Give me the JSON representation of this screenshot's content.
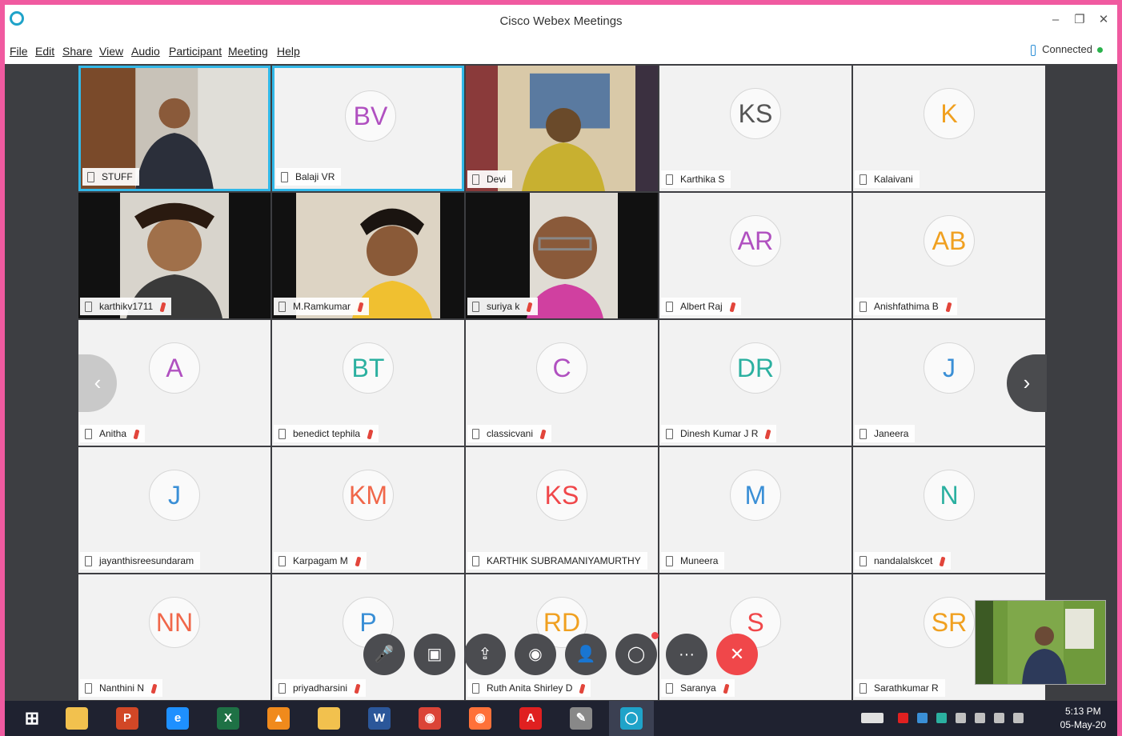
{
  "window": {
    "title": "Cisco Webex Meetings",
    "controls": [
      "–",
      "❐",
      "✕"
    ]
  },
  "menu": [
    "File",
    "Edit",
    "Share",
    "View",
    "Audio",
    "Participant",
    "Meeting",
    "Help"
  ],
  "connection": {
    "status": "Connected"
  },
  "participants": [
    {
      "name": "STUFF",
      "initials": "",
      "video": true,
      "muted": false,
      "color": "#444444"
    },
    {
      "name": "Balaji VR",
      "initials": "BV",
      "video": false,
      "muted": false,
      "color": "#b050c0"
    },
    {
      "name": "Devi",
      "initials": "",
      "video": true,
      "muted": false,
      "color": "#444444"
    },
    {
      "name": "Karthika S",
      "initials": "KS",
      "video": false,
      "muted": false,
      "color": "#555555"
    },
    {
      "name": "Kalaivani",
      "initials": "K",
      "video": false,
      "muted": false,
      "color": "#f0a020"
    },
    {
      "name": "karthikv1711",
      "initials": "",
      "video": true,
      "muted": true,
      "color": "#444444"
    },
    {
      "name": "M.Ramkumar",
      "initials": "",
      "video": true,
      "muted": true,
      "color": "#444444"
    },
    {
      "name": "suriya k",
      "initials": "",
      "video": true,
      "muted": true,
      "color": "#444444"
    },
    {
      "name": "Albert Raj",
      "initials": "AR",
      "video": false,
      "muted": true,
      "color": "#b050c0"
    },
    {
      "name": "Anishfathima B",
      "initials": "AB",
      "video": false,
      "muted": true,
      "color": "#f0a020"
    },
    {
      "name": "Anitha",
      "initials": "A",
      "video": false,
      "muted": true,
      "color": "#b050c0"
    },
    {
      "name": "benedict tephila",
      "initials": "BT",
      "video": false,
      "muted": true,
      "color": "#2bb0a0"
    },
    {
      "name": "classicvani",
      "initials": "C",
      "video": false,
      "muted": true,
      "color": "#b050c0"
    },
    {
      "name": "Dinesh Kumar J R",
      "initials": "DR",
      "video": false,
      "muted": true,
      "color": "#2bb0a0"
    },
    {
      "name": "Janeera",
      "initials": "J",
      "video": false,
      "muted": false,
      "color": "#3a8fd6"
    },
    {
      "name": "jayanthisreesundaram",
      "initials": "J",
      "video": false,
      "muted": false,
      "color": "#3a8fd6"
    },
    {
      "name": "Karpagam M",
      "initials": "KM",
      "video": false,
      "muted": true,
      "color": "#f0674a"
    },
    {
      "name": "KARTHIK SUBRAMANIYAMURTHY",
      "initials": "KS",
      "video": false,
      "muted": false,
      "color": "#f0474a"
    },
    {
      "name": "Muneera",
      "initials": "M",
      "video": false,
      "muted": false,
      "color": "#3a8fd6"
    },
    {
      "name": "nandalalskcet",
      "initials": "N",
      "video": false,
      "muted": true,
      "color": "#2bb0a0"
    },
    {
      "name": "Nanthini N",
      "initials": "NN",
      "video": false,
      "muted": true,
      "color": "#f0674a"
    },
    {
      "name": "priyadharsini",
      "initials": "P",
      "video": false,
      "muted": true,
      "color": "#3a8fd6"
    },
    {
      "name": "Ruth Anita Shirley D",
      "initials": "RD",
      "video": false,
      "muted": true,
      "color": "#f0a020"
    },
    {
      "name": "Saranya",
      "initials": "S",
      "video": false,
      "muted": true,
      "color": "#f0474a"
    },
    {
      "name": "Sarathkumar R",
      "initials": "SR",
      "video": false,
      "muted": false,
      "color": "#f0a020"
    }
  ],
  "active_speakers": [
    "STUFF",
    "Balaji VR"
  ],
  "controls": [
    {
      "name": "mute-button",
      "glyph": "🎤"
    },
    {
      "name": "video-button",
      "glyph": "▣"
    },
    {
      "name": "share-button",
      "glyph": "⇪"
    },
    {
      "name": "record-button",
      "glyph": "◉"
    },
    {
      "name": "participants-button",
      "glyph": "👤"
    },
    {
      "name": "chat-button",
      "glyph": "◯"
    },
    {
      "name": "more-button",
      "glyph": "···"
    },
    {
      "name": "end-meeting-button",
      "glyph": "✕"
    }
  ],
  "taskbar": {
    "apps": [
      {
        "name": "file-explorer",
        "glyph": "",
        "color": "#f2c14e"
      },
      {
        "name": "powerpoint",
        "glyph": "P",
        "color": "#d24726"
      },
      {
        "name": "internet-explorer",
        "glyph": "e",
        "color": "#1e90ff"
      },
      {
        "name": "excel",
        "glyph": "X",
        "color": "#1e7145"
      },
      {
        "name": "vlc",
        "glyph": "▲",
        "color": "#f08a1c"
      },
      {
        "name": "folder",
        "glyph": "",
        "color": "#f2c14e"
      },
      {
        "name": "word",
        "glyph": "W",
        "color": "#2b579a"
      },
      {
        "name": "chrome",
        "glyph": "◉",
        "color": "#db4437"
      },
      {
        "name": "firefox",
        "glyph": "◉",
        "color": "#ff7139"
      },
      {
        "name": "acrobat",
        "glyph": "A",
        "color": "#e02020"
      },
      {
        "name": "paint",
        "glyph": "✎",
        "color": "#888888"
      },
      {
        "name": "webex",
        "glyph": "◯",
        "color": "#1fa3c9"
      }
    ],
    "time": "5:13 PM",
    "date": "05-May-20"
  }
}
